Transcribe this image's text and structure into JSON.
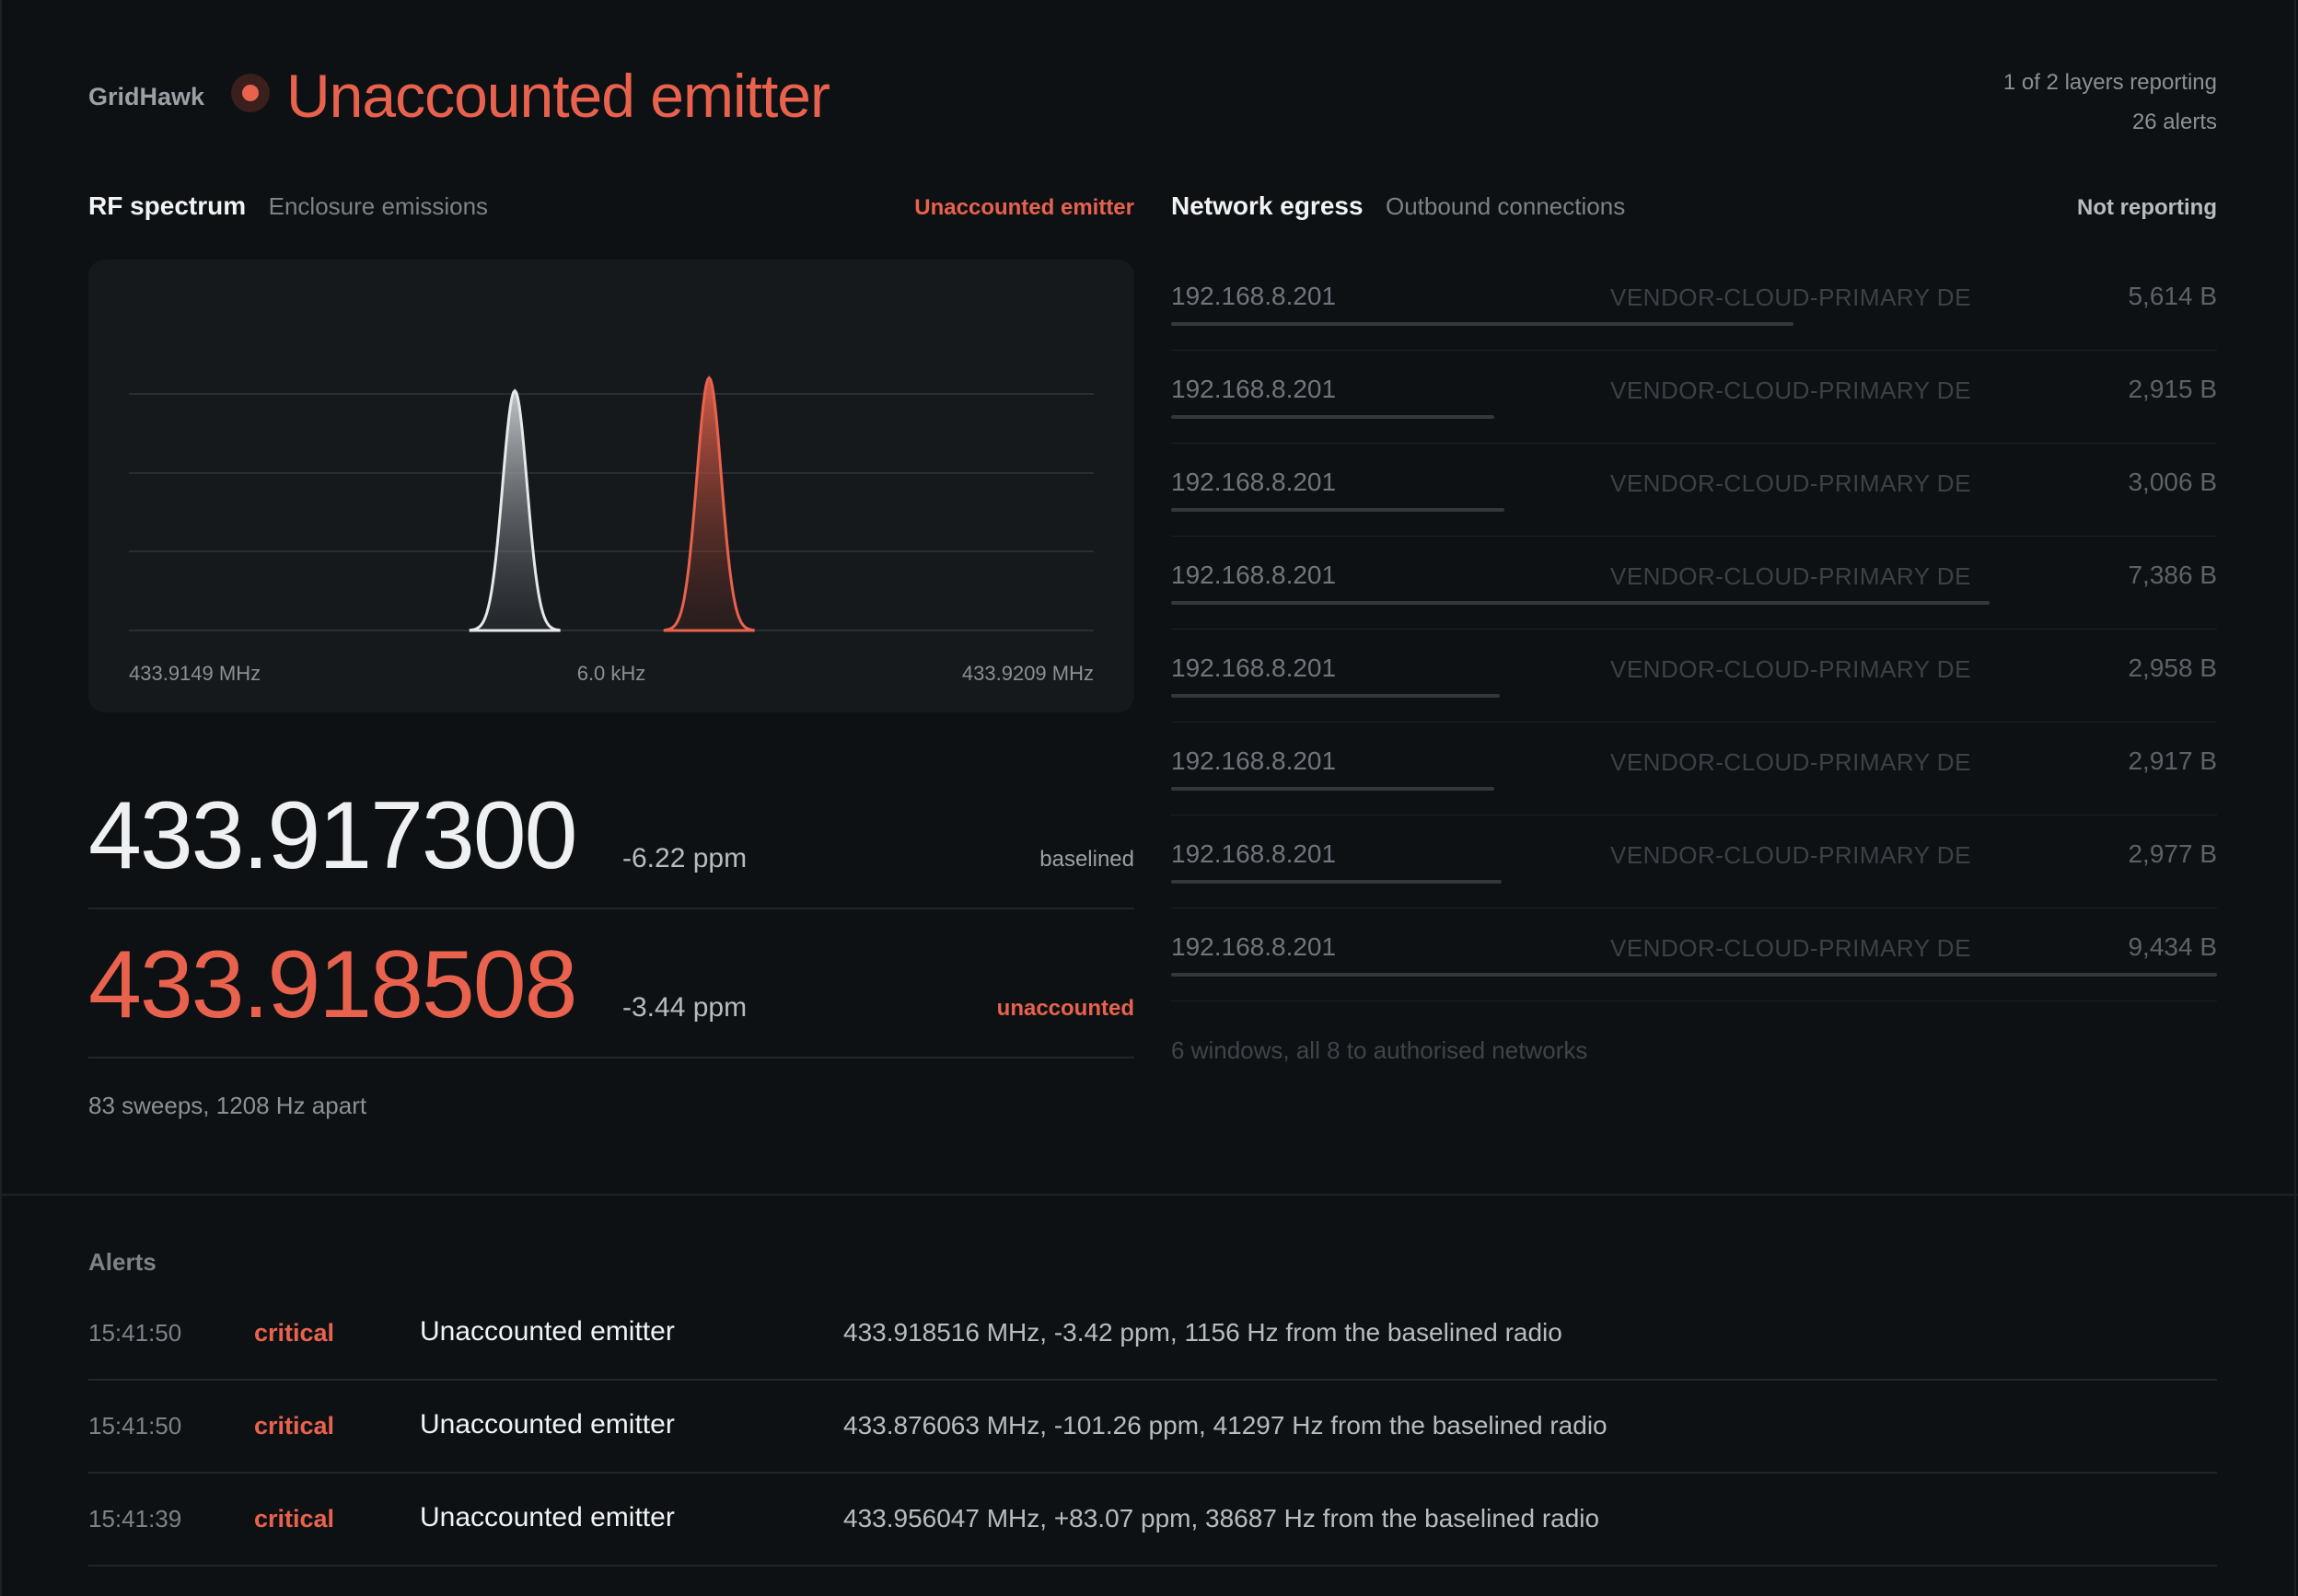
{
  "app": {
    "brand": "GridHawk",
    "headline": "Unaccounted emitter",
    "layers_reporting": "1 of 2 layers reporting",
    "alert_count": "26 alerts"
  },
  "colors": {
    "accent": "#e8624d",
    "background": "#0e1114",
    "panel": "#16191c"
  },
  "rf": {
    "title": "RF spectrum",
    "subtitle": "Enclosure emissions",
    "status": "Unaccounted emitter",
    "axis_left": "433.9149 MHz",
    "axis_center": "6.0 kHz",
    "axis_right": "433.9209 MHz",
    "readouts": [
      {
        "freq": "433.917300",
        "ppm": "-6.22 ppm",
        "tag": "baselined"
      },
      {
        "freq": "433.918508",
        "ppm": "-3.44 ppm",
        "tag": "unaccounted"
      }
    ],
    "sweeps": "83 sweeps, 1208 Hz apart"
  },
  "chart_data": {
    "type": "area",
    "xlim": [
      433.9149,
      433.9209
    ],
    "series": [
      {
        "peak_mhz": 433.9173,
        "relative_height": 0.92
      },
      {
        "peak_mhz": 433.918508,
        "relative_height": 0.97
      }
    ]
  },
  "egress": {
    "title": "Network egress",
    "subtitle": "Outbound connections",
    "status": "Not reporting",
    "rows": [
      {
        "ip": "192.168.8.201",
        "network": "VENDOR-CLOUD-PRIMARY DE",
        "bytes": "5,614 B",
        "share": 0.595
      },
      {
        "ip": "192.168.8.201",
        "network": "VENDOR-CLOUD-PRIMARY DE",
        "bytes": "2,915 B",
        "share": 0.309
      },
      {
        "ip": "192.168.8.201",
        "network": "VENDOR-CLOUD-PRIMARY DE",
        "bytes": "3,006 B",
        "share": 0.319
      },
      {
        "ip": "192.168.8.201",
        "network": "VENDOR-CLOUD-PRIMARY DE",
        "bytes": "7,386 B",
        "share": 0.783
      },
      {
        "ip": "192.168.8.201",
        "network": "VENDOR-CLOUD-PRIMARY DE",
        "bytes": "2,958 B",
        "share": 0.314
      },
      {
        "ip": "192.168.8.201",
        "network": "VENDOR-CLOUD-PRIMARY DE",
        "bytes": "2,917 B",
        "share": 0.309
      },
      {
        "ip": "192.168.8.201",
        "network": "VENDOR-CLOUD-PRIMARY DE",
        "bytes": "2,977 B",
        "share": 0.316
      },
      {
        "ip": "192.168.8.201",
        "network": "VENDOR-CLOUD-PRIMARY DE",
        "bytes": "9,434 B",
        "share": 1.0
      }
    ],
    "footer": "6 windows, all 8 to authorised networks"
  },
  "alerts": {
    "label": "Alerts",
    "items": [
      {
        "time": "15:41:50",
        "severity": "critical",
        "title": "Unaccounted emitter",
        "detail": "433.918516 MHz, -3.42 ppm, 1156 Hz from the baselined radio"
      },
      {
        "time": "15:41:50",
        "severity": "critical",
        "title": "Unaccounted emitter",
        "detail": "433.876063 MHz, -101.26 ppm, 41297 Hz from the baselined radio"
      },
      {
        "time": "15:41:39",
        "severity": "critical",
        "title": "Unaccounted emitter",
        "detail": "433.956047 MHz, +83.07 ppm, 38687 Hz from the baselined radio"
      }
    ]
  }
}
